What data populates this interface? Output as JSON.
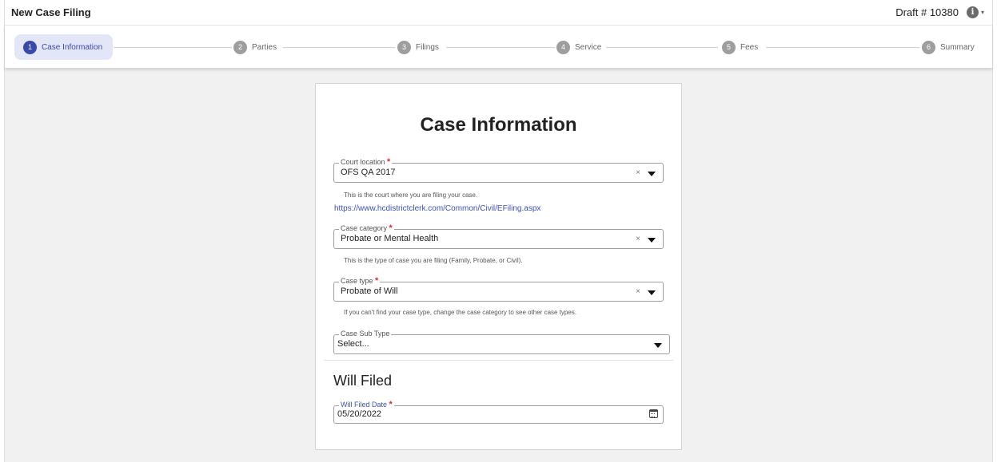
{
  "header": {
    "title": "New Case Filing",
    "draft_label": "Draft # 10380",
    "info_icon": "i",
    "caret": "▾"
  },
  "steps": [
    {
      "num": "1",
      "label": "Case Information",
      "active": true
    },
    {
      "num": "2",
      "label": "Parties"
    },
    {
      "num": "3",
      "label": "Filings"
    },
    {
      "num": "4",
      "label": "Service"
    },
    {
      "num": "5",
      "label": "Fees"
    },
    {
      "num": "6",
      "label": "Summary"
    }
  ],
  "form": {
    "title": "Case Information",
    "required_mark": "*",
    "clear_glyph": "×",
    "court_location": {
      "label": "Court location",
      "value": "OFS QA 2017",
      "hint": "This is the court where you are filing your case.",
      "link": "https://www.hcdistrictclerk.com/Common/Civil/EFiling.aspx"
    },
    "case_category": {
      "label": "Case category",
      "value": "Probate or Mental Health",
      "hint": "This is the type of case you are filing (Family, Probate, or Civil)."
    },
    "case_type": {
      "label": "Case type",
      "value": "Probate of Will",
      "hint": "If you can't find your case type, change the case category to see other case types."
    },
    "case_sub_type": {
      "label": "Case Sub Type",
      "value": "Select..."
    },
    "will_section": {
      "title": "Will Filed",
      "date_label": "Will Filed Date",
      "date_value": "05/20/2022",
      "date_icon": "calendar-icon"
    }
  },
  "colors": {
    "accent": "#3949ab",
    "required": "#d32f2f",
    "link": "#3f51b5"
  }
}
